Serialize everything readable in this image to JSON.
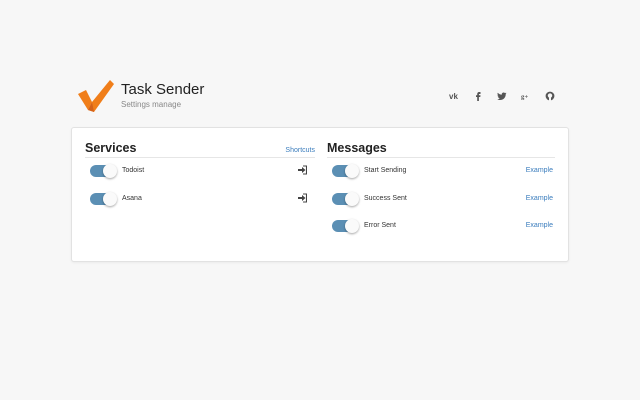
{
  "header": {
    "title": "Task Sender",
    "subtitle": "Settings manage",
    "colors": {
      "logo_orange": "#f07e1a",
      "logo_dark": "#d4621a"
    }
  },
  "social": [
    {
      "name": "vk-icon",
      "glyph": "vk"
    },
    {
      "name": "facebook-icon",
      "glyph": "f"
    },
    {
      "name": "twitter-icon",
      "glyph": "twitter"
    },
    {
      "name": "google-plus-icon",
      "glyph": "g+"
    },
    {
      "name": "github-icon",
      "glyph": "github"
    }
  ],
  "services": {
    "title": "Services",
    "link": "Shortcuts",
    "items": [
      {
        "label": "Todoist",
        "enabled": true,
        "action_icon": "sign-in-icon"
      },
      {
        "label": "Asana",
        "enabled": true,
        "action_icon": "sign-in-icon"
      }
    ]
  },
  "messages": {
    "title": "Messages",
    "items": [
      {
        "label": "Start Sending",
        "enabled": true,
        "link": "Example"
      },
      {
        "label": "Success Sent",
        "enabled": true,
        "link": "Example"
      },
      {
        "label": "Error Sent",
        "enabled": true,
        "link": "Example"
      }
    ]
  },
  "theme": {
    "toggle_on": "#5b8fb4",
    "link": "#3b7dbd",
    "background": "#f7f7f7"
  }
}
